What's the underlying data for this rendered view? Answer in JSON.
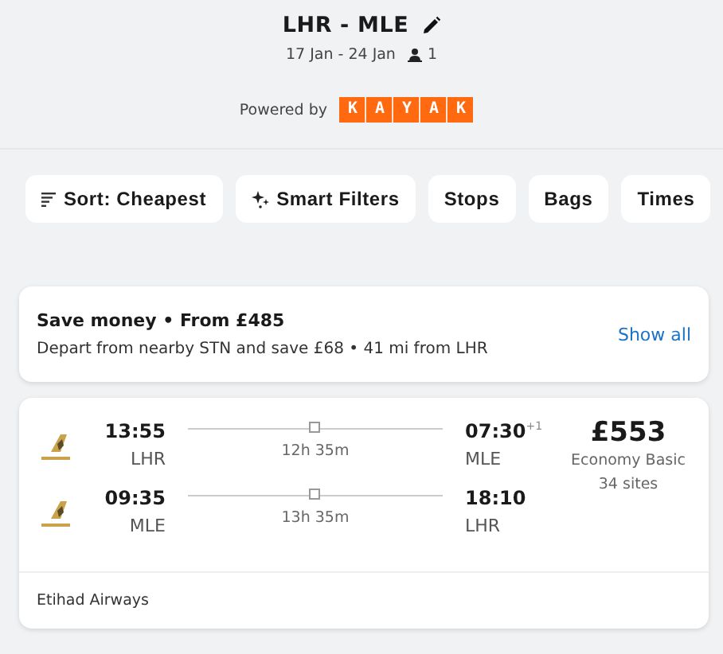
{
  "header": {
    "title": "LHR - MLE",
    "dates": "17 Jan - 24 Jan",
    "travellers": "1",
    "powered_by": "Powered by",
    "brand": "KAYAK"
  },
  "filters": [
    {
      "label": "Sort: Cheapest",
      "kind": "sort"
    },
    {
      "label": "Smart Filters",
      "kind": "smart"
    },
    {
      "label": "Stops",
      "kind": "plain"
    },
    {
      "label": "Bags",
      "kind": "plain"
    },
    {
      "label": "Times",
      "kind": "plain"
    }
  ],
  "promo": {
    "title": "Save money • From £485",
    "text": "Depart from nearby STN and save £68 • 41 mi from LHR",
    "action": "Show all"
  },
  "result": {
    "legs": [
      {
        "depart_time": "13:55",
        "depart_airport": "LHR",
        "duration": "12h 35m",
        "arrive_time": "07:30$^{+1}$",
        "arrive_airport": "MLE"
      },
      {
        "depart_time": "09:35",
        "depart_airport": "MLE",
        "duration": "13h 35m",
        "arrive_time": "18:10",
        "arrive_airport": "LHR"
      }
    ],
    "price": "£553",
    "fare": "Economy Basic",
    "sites": "34 sites",
    "airline": "Etihad Airways"
  }
}
